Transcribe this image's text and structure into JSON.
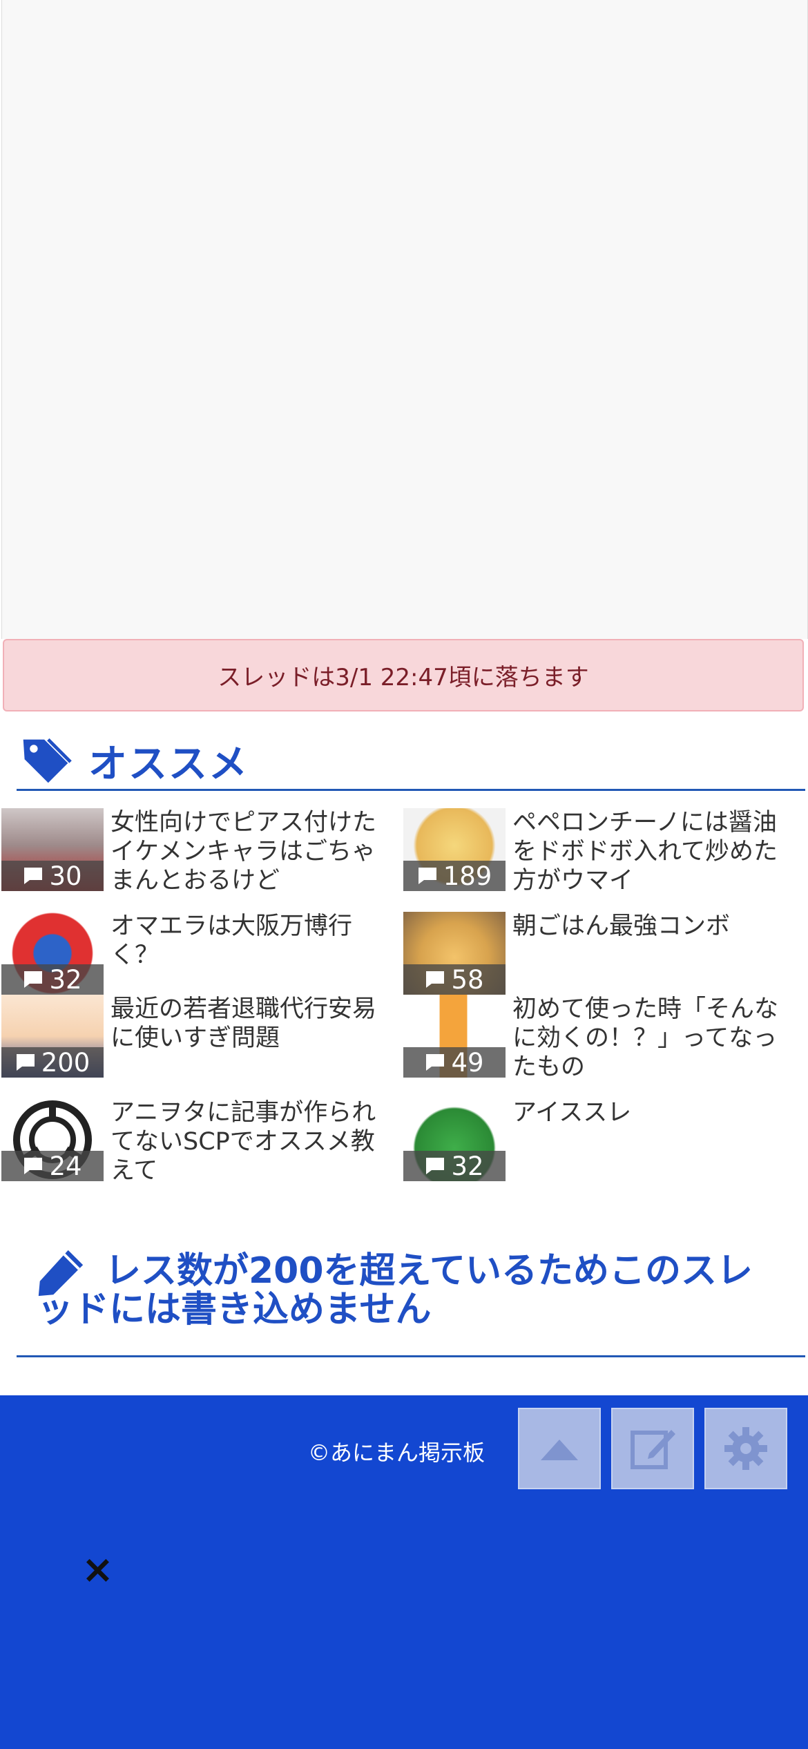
{
  "notice": {
    "text": "スレッドは3/1 22:47頃に落ちます"
  },
  "recommend": {
    "title": "オススメ",
    "items": [
      {
        "title": "女性向けでピアス付けたイケメンキャラはごちゃまんとおるけど",
        "count": "30"
      },
      {
        "title": "ペペロンチーノには醤油をドボドボ入れて炒めた方がウマイ",
        "count": "189"
      },
      {
        "title": "オマエラは大阪万博行く？",
        "count": "32"
      },
      {
        "title": "朝ごはん最強コンボ",
        "count": "58"
      },
      {
        "title": "最近の若者退職代行安易に使いすぎ問題",
        "count": "200"
      },
      {
        "title": "初めて使った時「そんなに効くの！？」ってなったもの",
        "count": "49"
      },
      {
        "title": "アニヲタに記事が作られてないSCPでオススメ教えて",
        "count": "24"
      },
      {
        "title": "アイススレ",
        "count": "32"
      }
    ]
  },
  "write": {
    "message": "レス数が200を超えているためこのスレッドには書き込めません"
  },
  "footer": {
    "copyright": "©あにまん掲示板",
    "buttons": [
      "scroll-top-icon",
      "edit-icon",
      "gear-icon"
    ]
  },
  "overlay": {
    "close": "×"
  },
  "colors": {
    "accent": "#1f4fc4",
    "footer": "#1347d1",
    "notice_bg": "#f8d7da"
  }
}
